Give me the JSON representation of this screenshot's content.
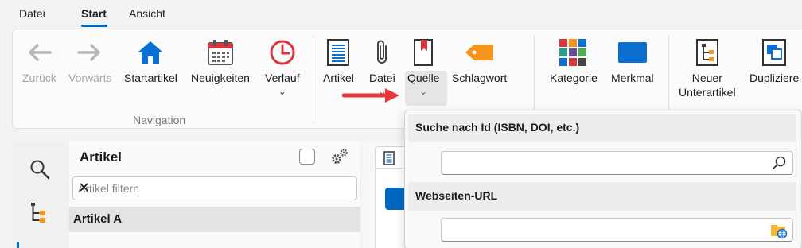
{
  "tabs": [
    {
      "label": "Datei"
    },
    {
      "label": "Start",
      "active": true
    },
    {
      "label": "Ansicht"
    }
  ],
  "ribbon": {
    "navigation": {
      "group_label": "Navigation",
      "back": "Zurück",
      "forward": "Vorwärts",
      "home": "Startartikel",
      "news": "Neuigkeiten",
      "history": "Verlauf"
    },
    "insert": {
      "article": "Artikel",
      "file": "Datei",
      "source": "Quelle",
      "tag": "Schlagwort"
    },
    "classify": {
      "category": "Kategorie",
      "feature": "Merkmal"
    },
    "structure": {
      "new_sub_line1": "Neuer",
      "new_sub_line2": "Unterartikel",
      "duplicate": "Dupliziere"
    }
  },
  "article_panel": {
    "title": "Artikel",
    "filter_placeholder": "Artikel filtern",
    "selected_item": "Artikel A"
  },
  "source_dropdown": {
    "id_search_label": "Suche nach Id (ISBN, DOI, etc.)",
    "id_search_value": "",
    "url_label": "Webseiten-URL",
    "url_value": ""
  },
  "colors": {
    "accent": "#0067c0",
    "home_icon": "#0a6fd0",
    "arrow": "#e8363c",
    "tag": "#f7941d"
  }
}
